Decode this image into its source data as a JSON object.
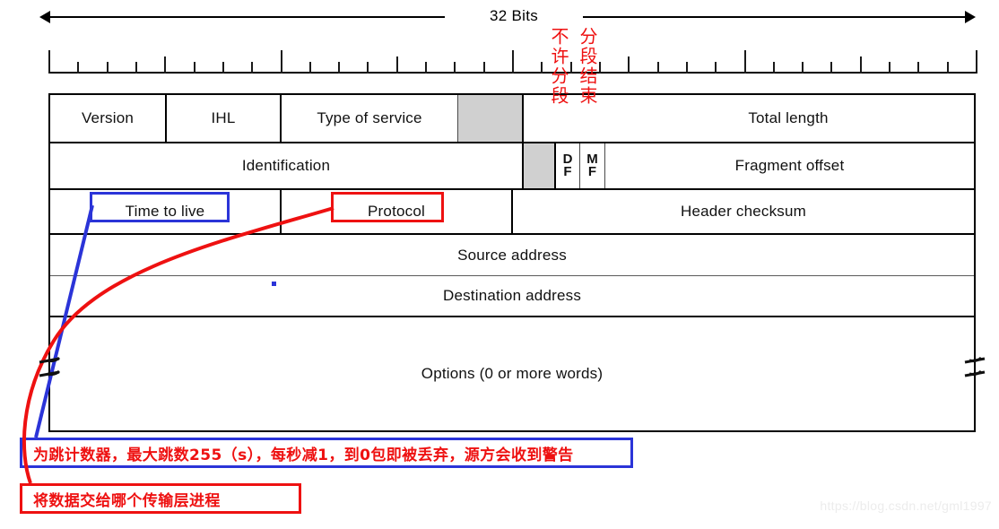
{
  "diagram": {
    "title_label": "32 Bits",
    "watermark": "https://blog.csdn.net/gml1997",
    "ruler": {
      "total_ticks": 32,
      "major_every": 8
    },
    "colors": {
      "blue": "#2b34d8",
      "red": "#ee1111",
      "grey_cell": "#d0d0d0",
      "border": "#000000",
      "watermark": "#ececec"
    }
  },
  "rows": [
    {
      "name": "row-1",
      "cells": [
        {
          "label": "Version",
          "shaded": false
        },
        {
          "label": "IHL",
          "shaded": false
        },
        {
          "label": "Type of service",
          "shaded": false
        },
        {
          "label": "",
          "shaded": true
        },
        {
          "label": "",
          "shaded": false
        },
        {
          "label": "Total length",
          "shaded": false
        }
      ]
    },
    {
      "name": "row-2",
      "cells": [
        {
          "label": "Identification",
          "shaded": false
        },
        {
          "label": "",
          "shaded": true
        },
        {
          "label": "D\nF",
          "shaded": false
        },
        {
          "label": "M\nF",
          "shaded": false
        },
        {
          "label": "Fragment offset",
          "shaded": false
        }
      ]
    },
    {
      "name": "row-3",
      "cells": [
        {
          "label": "Time to live",
          "shaded": false
        },
        {
          "label": "Protocol",
          "shaded": false
        },
        {
          "label": "Header checksum",
          "shaded": false
        }
      ]
    },
    {
      "name": "row-4",
      "cells": [
        {
          "label": "Source address",
          "shaded": false
        }
      ]
    },
    {
      "name": "row-5",
      "cells": [
        {
          "label": "Destination address",
          "shaded": false
        }
      ]
    },
    {
      "name": "row-6",
      "cells": [
        {
          "label": "Options (0 or more words)",
          "shaded": false
        }
      ]
    }
  ],
  "flag_annotations": [
    {
      "name": "df-annotation",
      "text": "不许分段"
    },
    {
      "name": "mf-annotation",
      "text": "分段结束"
    }
  ],
  "callouts": {
    "ttl_box": "Time to live",
    "protocol_box": "Protocol"
  },
  "notes": [
    {
      "name": "ttl-note",
      "text": "为跳计数器，最大跳数255（s），每秒减1，到0包即被丢弃，源方会收到警告",
      "color": "blue"
    },
    {
      "name": "protocol-note",
      "text": "将数据交给哪个传输层进程",
      "color": "red"
    }
  ]
}
